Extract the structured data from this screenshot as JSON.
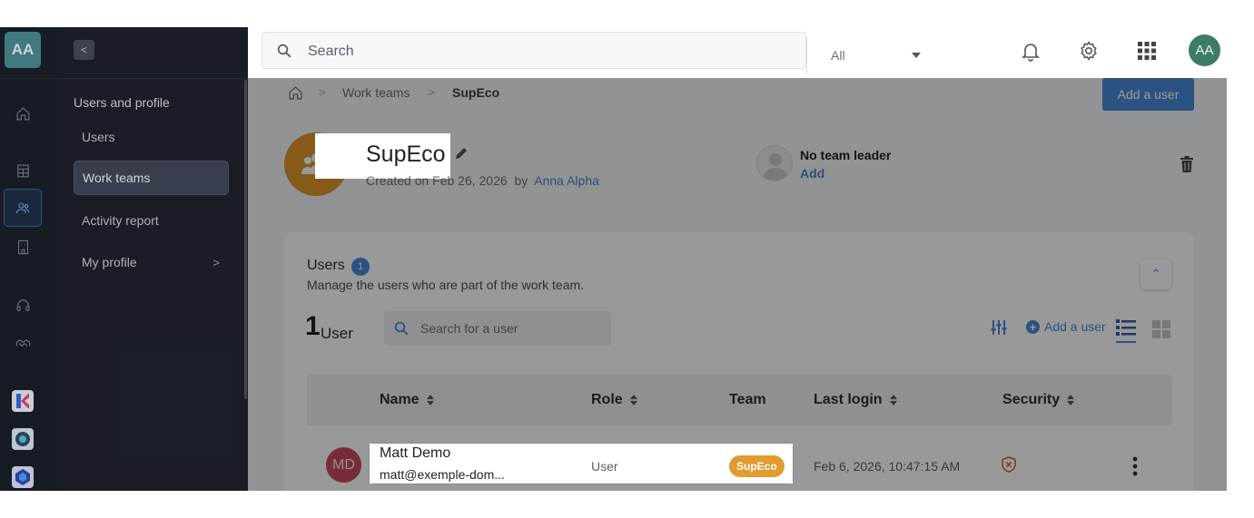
{
  "rail": {
    "logo": "AA",
    "icons": [
      "home-icon",
      "building-icon",
      "users-icon",
      "office-icon",
      "headset-icon",
      "handshake-icon"
    ],
    "apps": [
      "kdrive-app-icon",
      "kmeet-app-icon",
      "kchat-app-icon"
    ]
  },
  "sidebar": {
    "heading": "Users and profile",
    "items": [
      {
        "label": "Users"
      },
      {
        "label": "Work teams"
      },
      {
        "label": "Activity report"
      },
      {
        "label": "My profile"
      }
    ]
  },
  "topbar": {
    "search_placeholder": "Search",
    "search_scope": "All",
    "avatar": "AA"
  },
  "breadcrumb": {
    "items": [
      "Work teams",
      "SupEco"
    ]
  },
  "header": {
    "add_user_button": "Add a user",
    "team_name": "SupEco",
    "created_text": "Created on Feb 26, 2026",
    "created_by_prefix": "by",
    "created_by": "Anna Alpha",
    "leader_text": "No team leader",
    "leader_add": "Add"
  },
  "users_card": {
    "title": "Users",
    "count_badge": "1",
    "subtitle": "Manage the users who are part of the work team.",
    "big_count": "1",
    "count_word": "User",
    "search_placeholder": "Search for a user",
    "add_user_link": "Add a user",
    "columns": [
      "Name",
      "Role",
      "Team",
      "Last login",
      "Security"
    ],
    "rows": [
      {
        "initials": "MD",
        "name": "Matt Demo",
        "email": "matt@exemple-dom...",
        "role": "User",
        "team": "SupEco",
        "last_login": "Feb 6, 2026, 10:47:15 AM"
      }
    ]
  },
  "colors": {
    "accent": "#4a89d9",
    "team_orange": "#e39a2e",
    "avatar_red": "#c84a61",
    "sidebar_bg": "#1e222b"
  }
}
